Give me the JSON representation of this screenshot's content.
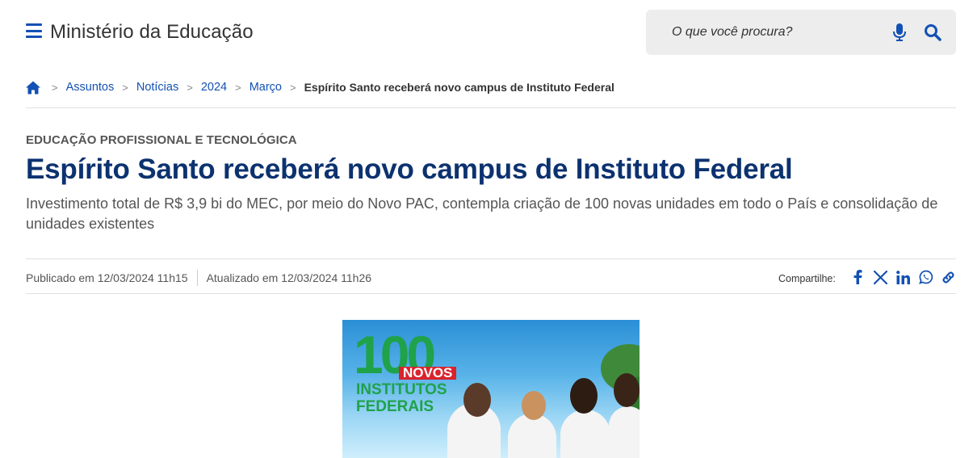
{
  "header": {
    "site_title": "Ministério da Educação",
    "search_placeholder": "O que você procura?"
  },
  "breadcrumb": {
    "items": [
      "Assuntos",
      "Notícias",
      "2024",
      "Março"
    ],
    "current": "Espírito Santo receberá novo campus de Instituto Federal"
  },
  "article": {
    "category": "EDUCAÇÃO PROFISSIONAL E TECNOLÓGICA",
    "title": "Espírito Santo receberá novo campus de Instituto Federal",
    "subtitle": "Investimento total de R$ 3,9 bi do MEC, por meio do Novo PAC, contempla criação de 100 novas unidades em todo o País e consolidação de unidades existentes",
    "published": "Publicado em 12/03/2024 11h15",
    "updated": "Atualizado em 12/03/2024 11h26"
  },
  "share": {
    "label": "Compartilhe:",
    "icons": [
      "facebook-icon",
      "x-icon",
      "linkedin-icon",
      "whatsapp-icon",
      "link-icon"
    ]
  },
  "hero": {
    "number": "100",
    "badge": "NOVOS",
    "line1": "INSTITUTOS",
    "line2": "FEDERAIS"
  },
  "colors": {
    "primary": "#1351b4",
    "headline": "#0c326f",
    "search_bg": "#ededed",
    "hero_green": "#1fa24a",
    "hero_red": "#d9232d"
  }
}
